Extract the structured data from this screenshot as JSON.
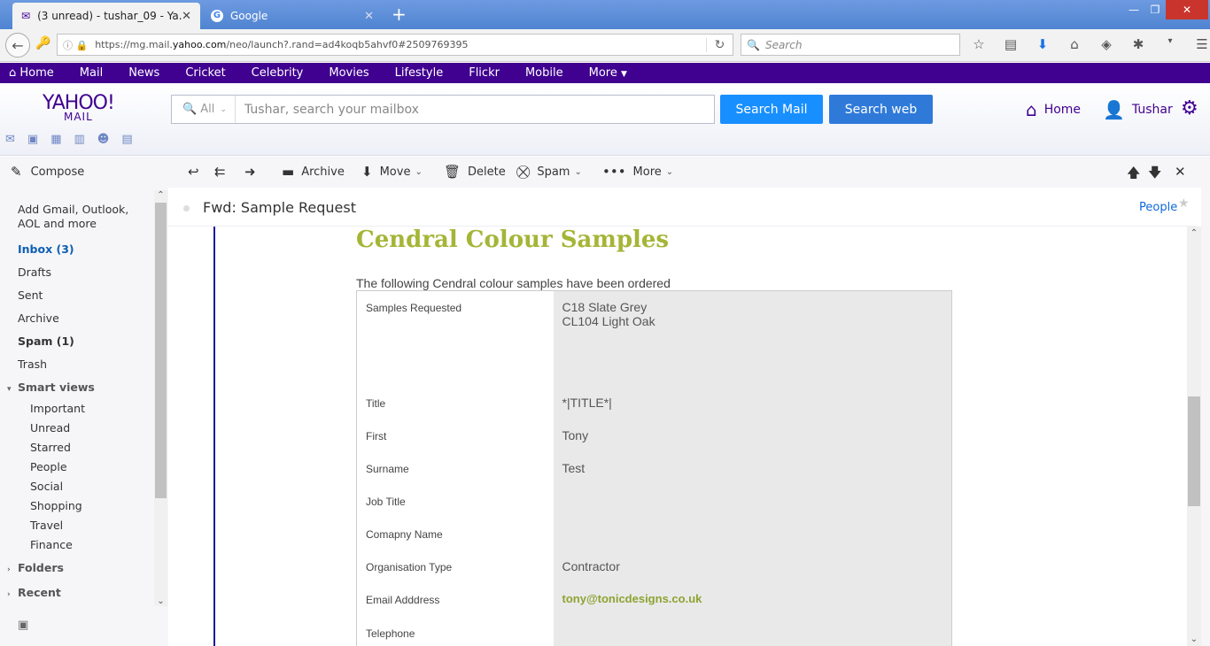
{
  "browser": {
    "tabs": [
      {
        "title": "(3 unread) - tushar_09 - Ya...",
        "icon": "envelope-icon",
        "active": true
      },
      {
        "title": "Google",
        "icon": "google-icon",
        "active": false
      }
    ],
    "url": {
      "prefix": "https://mg.mail.",
      "domain": "yahoo.com",
      "suffix": "/neo/launch?.rand=ad4koqb5ahvf0#2509769395"
    },
    "search_placeholder": "Search"
  },
  "yahoo_nav": [
    "Home",
    "Mail",
    "News",
    "Cricket",
    "Celebrity",
    "Movies",
    "Lifestyle",
    "Flickr",
    "Mobile",
    "More"
  ],
  "header": {
    "logo_top": "YAHOO!",
    "logo_bottom": "MAIL",
    "search_scope": "All",
    "search_placeholder": "Tushar, search your mailbox",
    "search_mail_btn": "Search Mail",
    "search_web_btn": "Search web",
    "home_label": "Home",
    "user_label": "Tushar"
  },
  "sidebar": {
    "compose": "Compose",
    "add_accounts": "Add Gmail, Outlook, AOL and more",
    "inbox": "Inbox (3)",
    "drafts": "Drafts",
    "sent": "Sent",
    "archive": "Archive",
    "spam": "Spam (1)",
    "trash": "Trash",
    "smart_views": "Smart views",
    "smart_items": [
      "Important",
      "Unread",
      "Starred",
      "People",
      "Social",
      "Shopping",
      "Travel",
      "Finance"
    ],
    "folders": "Folders",
    "recent": "Recent"
  },
  "toolbar": {
    "archive": "Archive",
    "move": "Move",
    "delete": "Delete",
    "spam": "Spam",
    "more": "More"
  },
  "message": {
    "subject": "Fwd: Sample Request",
    "people": "People",
    "heading": "Cendral Colour Samples",
    "intro": "The following Cendral colour samples have been ordered",
    "rows": [
      {
        "label": "Samples Requested",
        "value": "C18 Slate Grey",
        "value2": "CL104 Light Oak"
      },
      {
        "label": "Title",
        "value": "*|TITLE*|"
      },
      {
        "label": "First",
        "value": "Tony"
      },
      {
        "label": "Surname",
        "value": "Test"
      },
      {
        "label": "Job Title",
        "value": ""
      },
      {
        "label": "Comapny Name",
        "value": ""
      },
      {
        "label": "Organisation Type",
        "value": "Contractor"
      },
      {
        "label": "Email Adddress",
        "value": "tony@tonicdesigns.co.uk"
      },
      {
        "label": "Telephone",
        "value": ""
      }
    ]
  }
}
